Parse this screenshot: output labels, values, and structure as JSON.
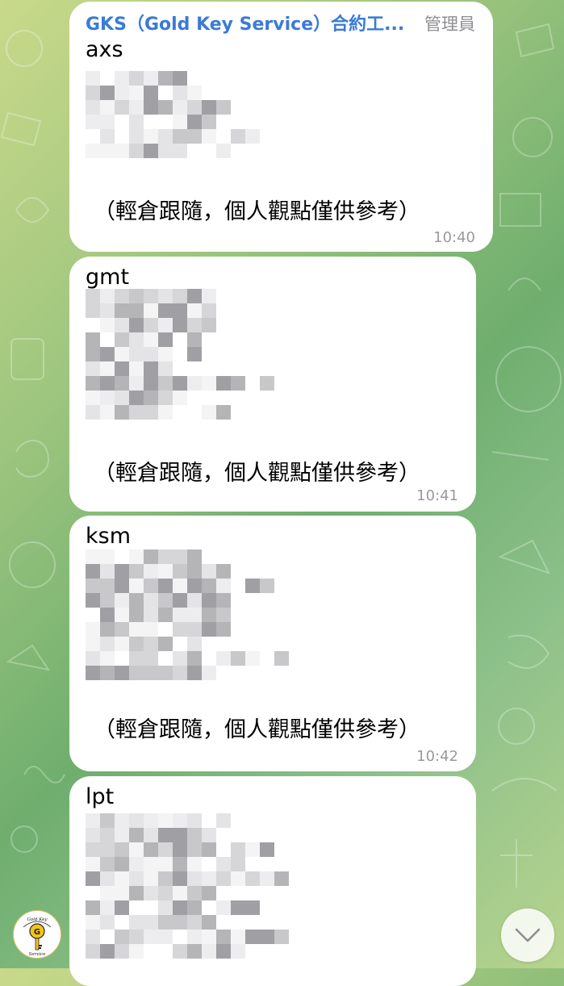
{
  "messages": [
    {
      "sender": "GKS（Gold Key Service）合約工...",
      "role": "管理員",
      "ticker": "axs",
      "disclaimer": "（輕倉跟隨，個人觀點僅供參考）",
      "time": "10:40"
    },
    {
      "ticker": "gmt",
      "disclaimer": "（輕倉跟隨，個人觀點僅供參考）",
      "time": "10:41"
    },
    {
      "ticker": "ksm",
      "disclaimer": "（輕倉跟隨，個人觀點僅供參考）",
      "time": "10:42"
    },
    {
      "ticker": "lpt"
    }
  ],
  "avatar": {
    "name": "gold-key-service-logo",
    "logo_text_top": "Gold Key",
    "logo_text_bottom": "Service",
    "logo_letter": "G"
  },
  "scroll_button": {
    "icon": "chevron-down-icon"
  },
  "colors": {
    "sender_name": "#3a7bd5",
    "role_text": "#8e8e93",
    "time_text": "#9a9a9e",
    "bubble": "#ffffff"
  }
}
